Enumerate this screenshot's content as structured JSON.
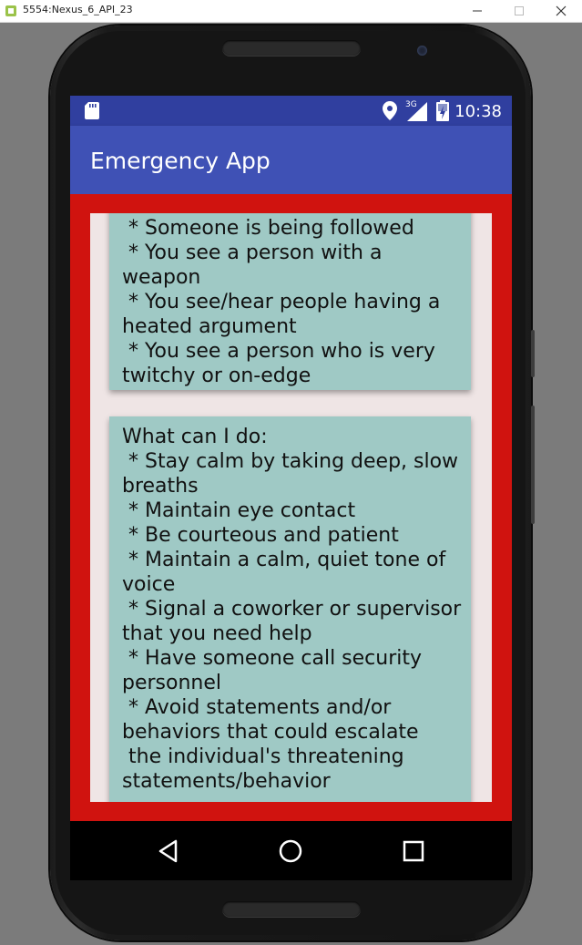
{
  "window": {
    "title": "5554:Nexus_6_API_23"
  },
  "status_bar": {
    "network_label": "3G",
    "time": "10:38",
    "icons": [
      "sd-card-icon",
      "location-icon",
      "signal-icon",
      "battery-icon"
    ]
  },
  "app_bar": {
    "title": "Emergency App"
  },
  "cards": [
    {
      "text": " * Someone is being followed\n * You see a person with a weapon\n * You see/hear people having a heated argument\n * You see a person who is very twitchy or on-edge"
    },
    {
      "text": "What can I do:\n * Stay calm by taking deep, slow breaths\n * Maintain eye contact\n * Be courteous and patient\n * Maintain a calm, quiet tone of voice\n * Signal a coworker or supervisor that you need help\n * Have someone call security personnel\n * Avoid statements and/or behaviors that could escalate\n the individual's threatening statements/behavior"
    }
  ],
  "colors": {
    "status_bar": "#303f9f",
    "app_bar": "#3f51b5",
    "content_background": "#d0130f",
    "panel_background": "#efe5e5",
    "card_background": "#9fc9c5"
  },
  "nav_bar": {
    "buttons": [
      "back-icon",
      "home-icon",
      "recents-icon"
    ]
  }
}
